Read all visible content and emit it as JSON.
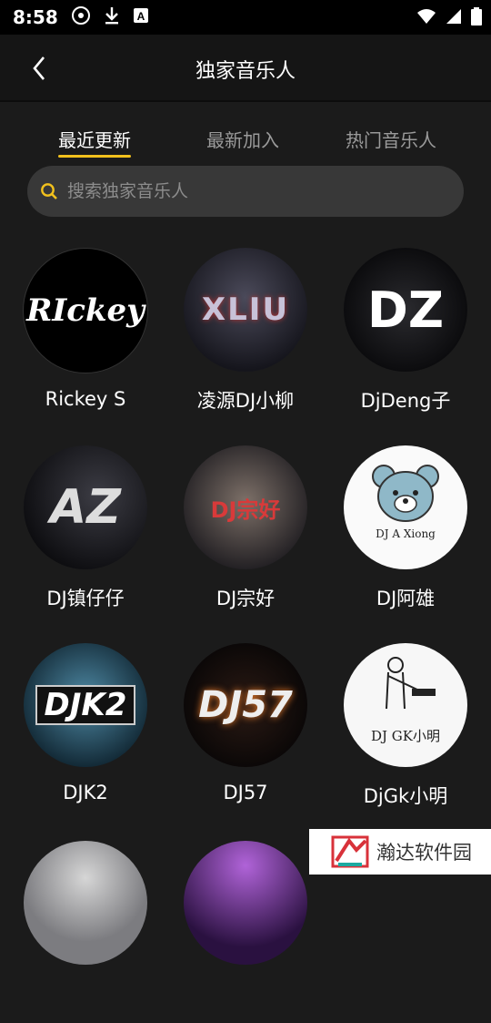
{
  "status": {
    "time": "8:58"
  },
  "header": {
    "title": "独家音乐人"
  },
  "tabs": [
    {
      "label": "最近更新",
      "active": true
    },
    {
      "label": "最新加入",
      "active": false
    },
    {
      "label": "热门音乐人",
      "active": false
    }
  ],
  "search": {
    "placeholder": "搜索独家音乐人"
  },
  "artists": [
    {
      "name": "Rickey S",
      "logo": "RIckey"
    },
    {
      "name": "凌源DJ小柳",
      "logo": "XLIU"
    },
    {
      "name": "DjDeng子",
      "logo": "DZ"
    },
    {
      "name": "DJ镇仔仔",
      "logo": "AZ"
    },
    {
      "name": "DJ宗好",
      "logo": "DJ宗好"
    },
    {
      "name": "DJ阿雄",
      "logo": "DJ A Xiong"
    },
    {
      "name": "DJK2",
      "logo": "DJK2"
    },
    {
      "name": "DJ57",
      "logo": "DJ57"
    },
    {
      "name": "DjGk小明",
      "logo": "DJ GK小明"
    }
  ],
  "watermark": {
    "text": "瀚达软件园"
  },
  "colors": {
    "accent": "#f2c11d",
    "background": "#1b1b1b",
    "search_bg": "#383838"
  }
}
